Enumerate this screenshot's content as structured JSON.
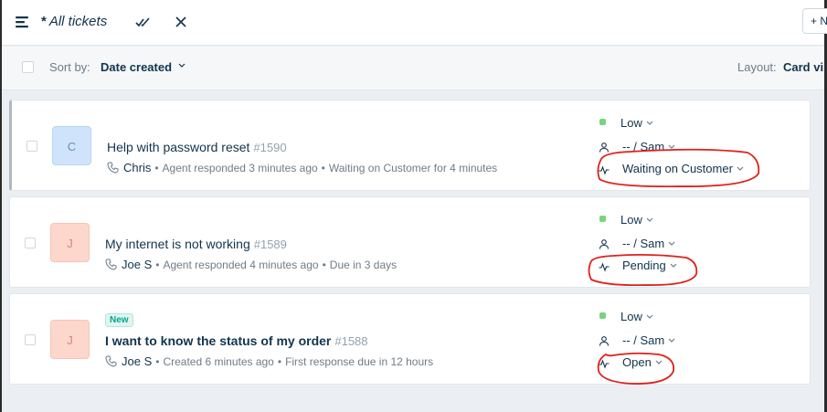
{
  "header": {
    "star": "*",
    "title": "All tickets",
    "new_button_label": "+ N"
  },
  "sortbar": {
    "sort_label": "Sort by:",
    "sort_value": "Date created",
    "layout_label": "Layout:",
    "layout_value": "Card vi"
  },
  "tickets": [
    {
      "avatar_initial": "C",
      "subject": "Help with password reset",
      "number": "#1590",
      "contact": "Chris",
      "activity": "Agent responded 3 minutes ago",
      "due": "Waiting on Customer for 4 minutes",
      "priority": "Low",
      "assignee": "-- / Sam",
      "status": "Waiting on Customer",
      "is_new": false
    },
    {
      "avatar_initial": "J",
      "subject": "My internet is not working",
      "number": "#1589",
      "contact": "Joe S",
      "activity": "Agent responded 4 minutes ago",
      "due": "Due in 3 days",
      "priority": "Low",
      "assignee": "-- / Sam",
      "status": "Pending",
      "is_new": false
    },
    {
      "avatar_initial": "J",
      "badge": "New",
      "subject": "I want to know the status of my order",
      "number": "#1588",
      "contact": "Joe S",
      "activity": "Created 6 minutes ago",
      "due": "First response due in 12 hours",
      "priority": "Low",
      "assignee": "-- / Sam",
      "status": "Open",
      "is_new": true
    }
  ],
  "colors": {
    "priority_low": "#7ad37d",
    "annotation": "#e0201b",
    "text_primary": "#12344d",
    "text_secondary": "#6f7c87"
  },
  "icons": {
    "menu": "menu-icon",
    "mark_read": "double-check-icon",
    "close": "close-icon",
    "phone": "phone-icon",
    "agent": "person-icon",
    "status": "pulse-icon"
  }
}
